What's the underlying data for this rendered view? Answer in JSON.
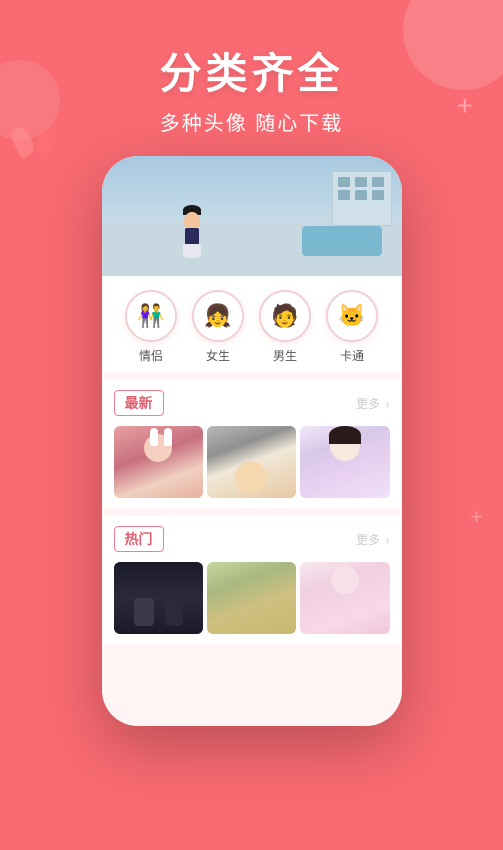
{
  "header": {
    "title": "分类齐全",
    "subtitle": "多种头像 随心下载"
  },
  "categories": [
    {
      "id": "couples",
      "label": "情侣",
      "emoji": "👫"
    },
    {
      "id": "girls",
      "label": "女生",
      "emoji": "👧"
    },
    {
      "id": "boys",
      "label": "男生",
      "emoji": "🧑"
    },
    {
      "id": "cartoon",
      "label": "卡通",
      "emoji": "🐱"
    }
  ],
  "sections": [
    {
      "id": "latest",
      "tag": "最新",
      "more_label": "更多",
      "more_arrow": "›",
      "images": [
        {
          "id": "girl-bunny",
          "alt": "girl with bunny hat"
        },
        {
          "id": "baby-face",
          "alt": "baby face"
        },
        {
          "id": "anime-girl",
          "alt": "anime girl"
        }
      ]
    },
    {
      "id": "hot",
      "tag": "热门",
      "more_label": "更多",
      "more_arrow": "›",
      "images": [
        {
          "id": "couple-dark",
          "alt": "couple dark"
        },
        {
          "id": "group-photo",
          "alt": "group photo"
        },
        {
          "id": "anime-pink",
          "alt": "anime pink girl"
        }
      ]
    }
  ],
  "decorations": {
    "plus1": "+",
    "plus2": "+"
  }
}
